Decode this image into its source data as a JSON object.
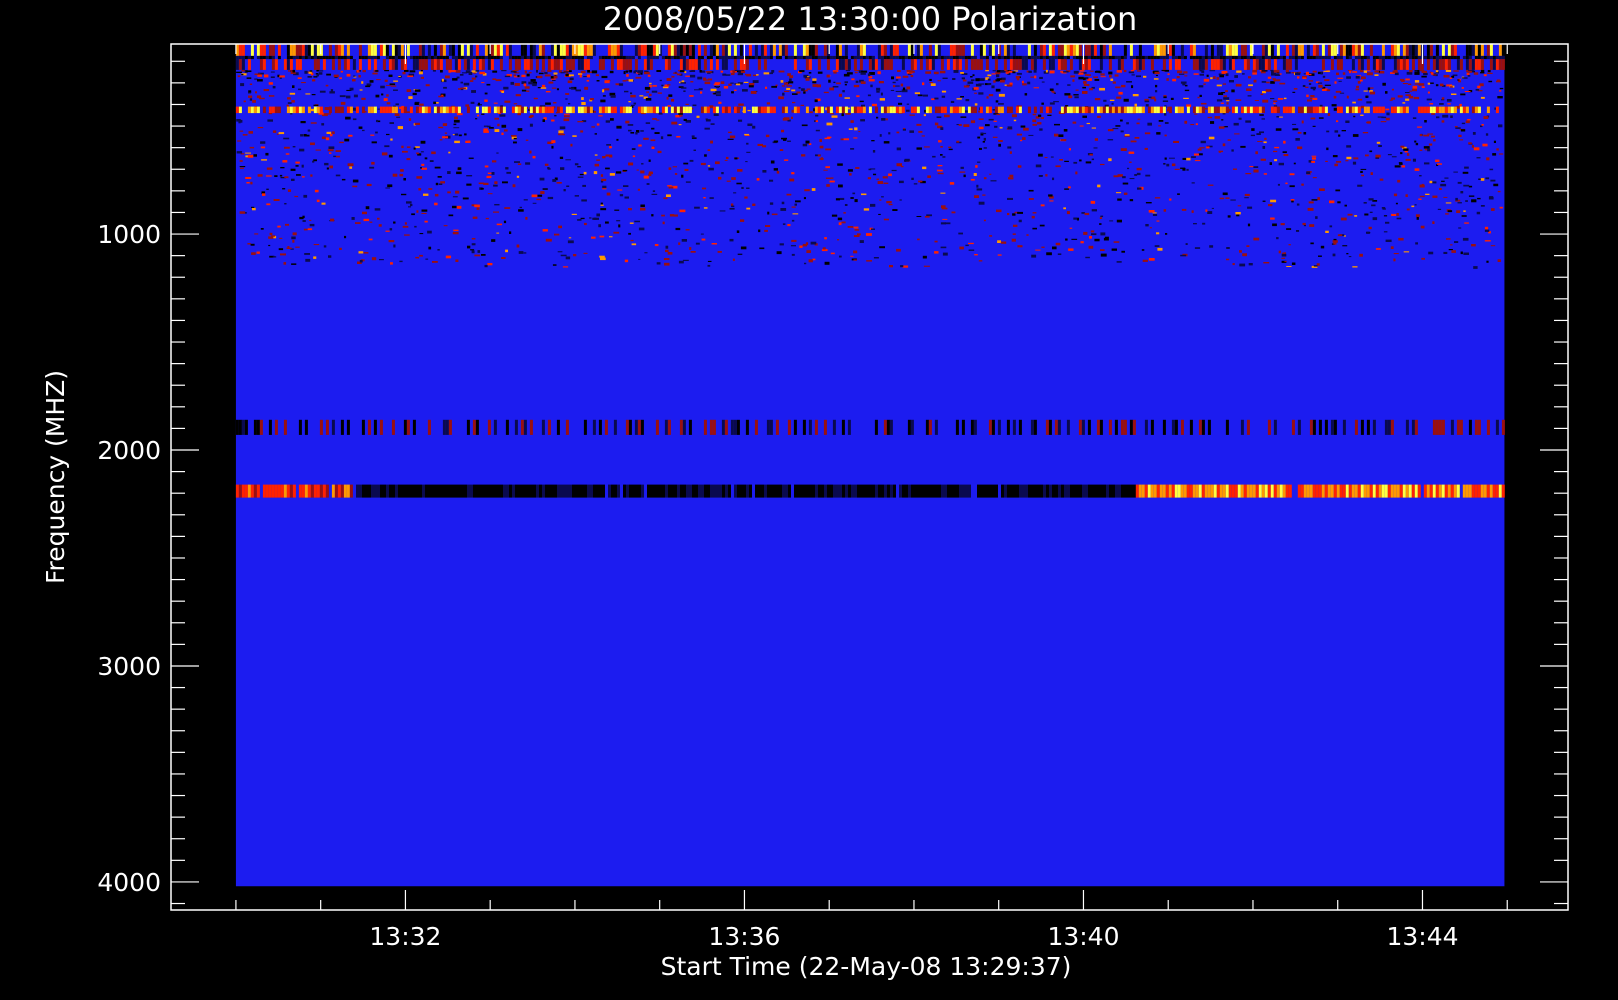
{
  "chart_data": {
    "type": "heatmap",
    "title": "2008/05/22 13:30:00 Polarization",
    "xlabel": "Start Time (22-May-08 13:29:37)",
    "ylabel": "Frequency (MHZ)",
    "x_ticks": [
      {
        "value": 2.383,
        "label": "13:32"
      },
      {
        "value": 6.383,
        "label": "13:36"
      },
      {
        "value": 10.383,
        "label": "13:40"
      },
      {
        "value": 14.383,
        "label": "13:44"
      }
    ],
    "y_ticks": [
      {
        "value": 1000,
        "label": "1000"
      },
      {
        "value": 2000,
        "label": "2000"
      },
      {
        "value": 3000,
        "label": "3000"
      },
      {
        "value": 4000,
        "label": "4000"
      }
    ],
    "xlim": [
      -0.383,
      16.1
    ],
    "ylim": [
      4130,
      120
    ],
    "data_extent": {
      "x": [
        0.383,
        15.35
      ],
      "y": [
        120,
        4020
      ]
    },
    "y_inverted": true,
    "background_value": "blue",
    "colormap": [
      "#000000",
      "#0a0a50",
      "#1c1cf0",
      "#9a1010",
      "#ff2200",
      "#ff9900",
      "#ffff40"
    ],
    "features": [
      {
        "name": "top-band",
        "freq_range": [
          120,
          175
        ],
        "intensity": "strong mixed"
      },
      {
        "name": "dark-line",
        "freq_range": [
          175,
          190
        ],
        "intensity": "absorption"
      },
      {
        "name": "red-band",
        "freq_range": [
          190,
          240
        ],
        "intensity": "strong emission"
      },
      {
        "name": "yellow-band",
        "freq_range": [
          410,
          440
        ],
        "intensity": "strong emission"
      },
      {
        "name": "speckle-zone",
        "freq_range": [
          240,
          1150
        ],
        "intensity": "patchy"
      },
      {
        "name": "line-1900",
        "freq_range": [
          1860,
          1930
        ],
        "intensity": "faint emission"
      },
      {
        "name": "band-2190",
        "freq_range": [
          2160,
          2220
        ],
        "intensity": "emission at ends, absorption mid"
      }
    ],
    "colors": {
      "background": "#000000",
      "axis": "#ffffff",
      "field": "#1c1cf0"
    }
  }
}
